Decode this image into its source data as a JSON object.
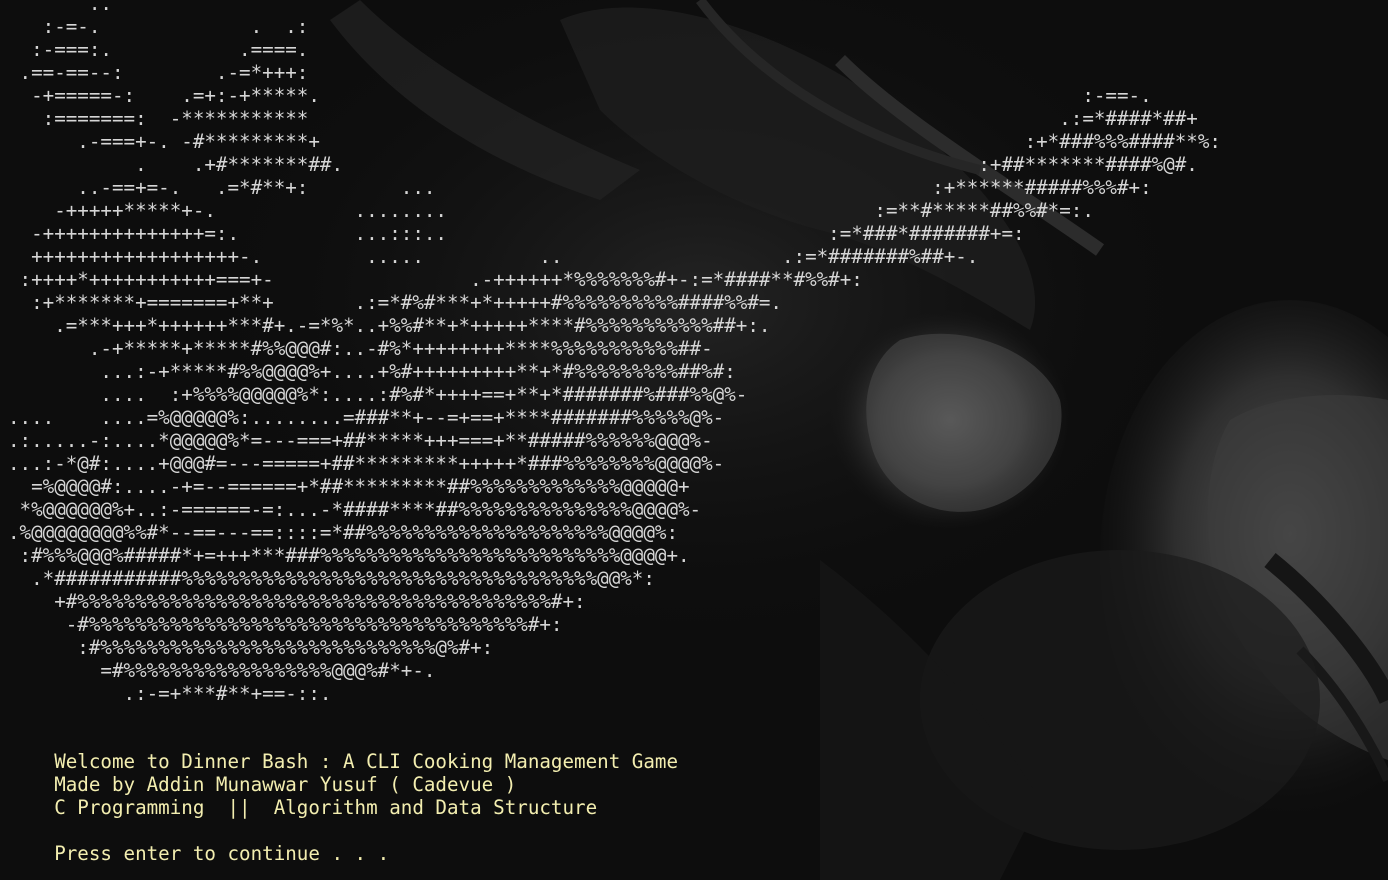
{
  "ascii_art": [
    "       ..",
    "   :-=-.             .  .:",
    "  :-===:.           .====.",
    " .==-==--:        .-=*+++:",
    "  -+=====-:    .=+:-+*****.                                                                  :-==-.",
    "   :=======:  -***********                                                                 .:=*####*##+",
    "      .-===+-. -#*********+                                                             :+*###%%%####**%:",
    "           .    .+#*******##.                                                       :+##*******####%@#.",
    "      ..-==+=-.   .=*#**+:        ...                                           :+******#####%%%#+:",
    "    -+++++*****+-.            ........                                     :=**#*****##%%#*=:.",
    "  -++++++++++++++=:.          ...:::..                                 :=*###*#######+=:",
    "  ++++++++++++++++++-.         .....          ..                   .:=*#######%##+-.",
    " :++++*+++++++++++===+-                 .-++++++*%%%%%%%#+-:=*####**#%%#+:",
    "  :+*******+=======+**+       .:=*#%#***+*+++++#%%%%%%%%%%####%%#=.",
    "    .=***+++*++++++***#+.-=*%*..+%%#**+*+++++****#%%%%%%%%%%%##+:.",
    "       .-+*****+*****#%%@@@#:..-#%*++++++++****%%%%%%%%%%%##-",
    "        ...:-+*****#%%@@@@%+....+%#+++++++++**+*#%%%%%%%%%##%#:",
    "        ....  :+%%%%@@@@@%*:....:#%#*++++==+**+*#######%###%%@%-",
    "....    ....=%@@@@@%:........=###**+--=+==+****#######%%%%%@%-",
    ".:.....-:....*@@@@@%*=---===+##*****+++===+**#####%%%%%%@@@%-",
    "...:-*@#:....+@@@#=---=====+##*********+++++*###%%%%%%%%@@@@%-",
    "  =%@@@@#:....-+=--======+*##*********##%%%%%%%%%%%%%@@@@@+",
    " *%@@@@@@%+..:-======-=:...-*####****##%%%%%%%%%%%%%%%@@@@%-",
    ".%@@@@@@@@%%#*--==---==::::=*##%%%%%%%%%%%%%%%%%%%%%@@@@%:",
    " :#%%%@@@%#####*+=+++***###%%%%%%%%%%%%%%%%%%%%%%%%%%@@@@+.",
    "  .*###########%%%%%%%%%%%%%%%%%%%%%%%%%%%%%%%%%%%%@@%*:",
    "    +#%%%%%%%%%%%%%%%%%%%%%%%%%%%%%%%%%%%%%%%%%#+:",
    "     -#%%%%%%%%%%%%%%%%%%%%%%%%%%%%%%%%%%%%%%#+:",
    "      :#%%%%%%%%%%%%%%%%%%%%%%%%%%%%%@%#+:",
    "        =#%%%%%%%%%%%%%%%%%%@@@%#*+-.",
    "          .:-=+***#**+==-::."
  ],
  "welcome": {
    "title": "    Welcome to Dinner Bash : A CLI Cooking Management Game",
    "author": "    Made by Addin Munawwar Yusuf ( Cadevue )",
    "course": "    C Programming  ||  Algorithm and Data Structure",
    "prompt": "    Press enter to continue . . ."
  },
  "colors": {
    "background": "#0d0d0d",
    "ascii_text": "#d6d6d6",
    "welcome_text": "#f3eeb0"
  }
}
